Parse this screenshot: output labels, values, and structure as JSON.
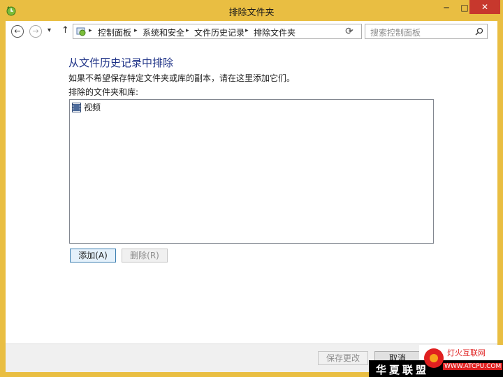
{
  "window": {
    "title": "排除文件夹",
    "controls": {
      "minimize": "─",
      "maximize": "□",
      "close": "✕"
    }
  },
  "nav": {
    "back": "←",
    "forward": "→",
    "recent": "▾",
    "up": "↑",
    "breadcrumb": [
      "控制面板",
      "系统和安全",
      "文件历史记录",
      "排除文件夹"
    ],
    "breadcrumb_separator": "▸",
    "address_dropdown": "⌄",
    "refresh": "⟳",
    "search_placeholder": "搜索控制面板"
  },
  "main": {
    "heading": "从文件历史记录中排除",
    "description": "如果不希望保存特定文件夹或库的副本，请在这里添加它们。",
    "list_label": "排除的文件夹和库:",
    "items": [
      {
        "label": "视频",
        "icon": "video-library-icon"
      }
    ],
    "add_button": "添加(A)",
    "remove_button": "删除(R)"
  },
  "footer": {
    "save_button": "保存更改",
    "cancel_button": "取消"
  },
  "watermark": {
    "brand_cn": "华夏联盟",
    "logo_text": "灯火互联网",
    "logo_url": "WWW.ATCPU.COM"
  },
  "colors": {
    "frame": "#e9be42",
    "heading": "#1e3287",
    "close": "#c7382d"
  }
}
